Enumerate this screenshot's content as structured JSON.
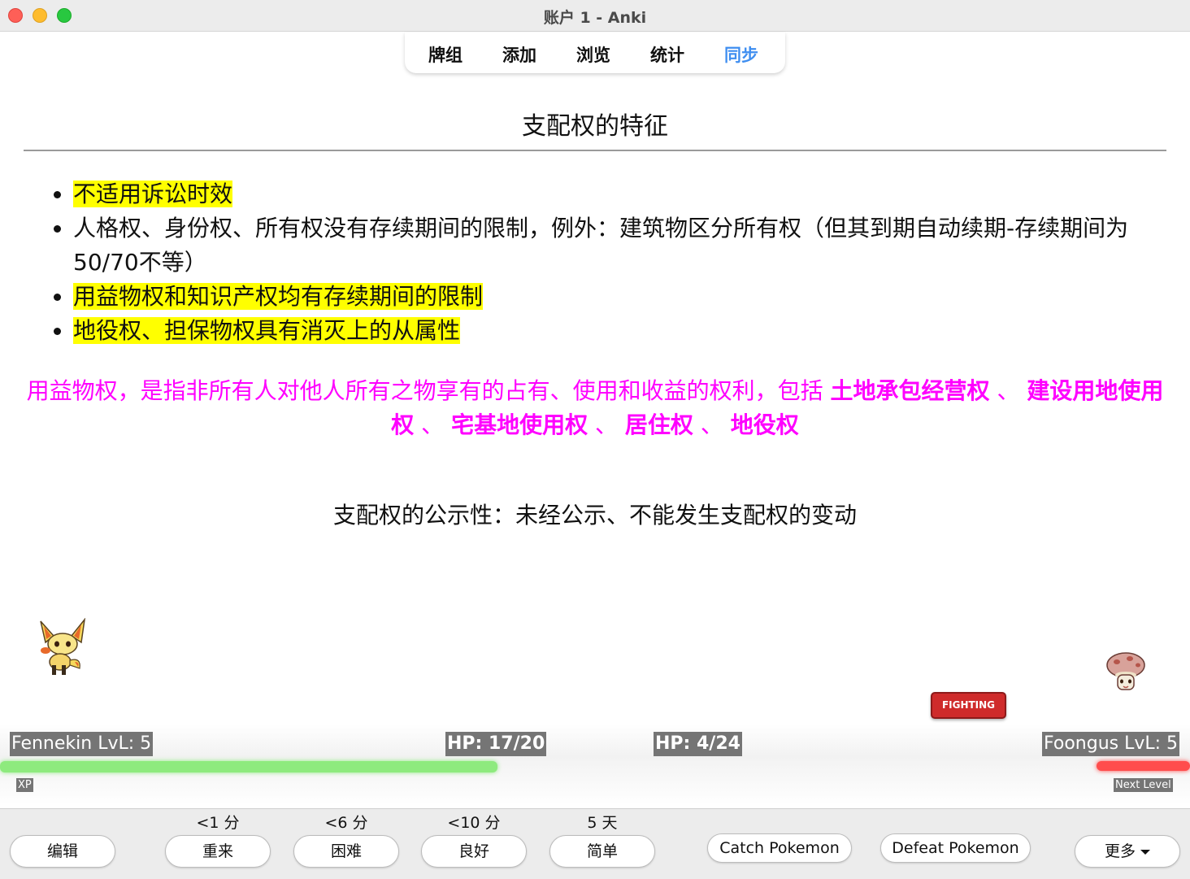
{
  "window": {
    "title": "账户 1 - Anki"
  },
  "toolbar": {
    "items": [
      {
        "label": "牌组"
      },
      {
        "label": "添加"
      },
      {
        "label": "浏览"
      },
      {
        "label": "统计"
      },
      {
        "label": "同步",
        "active": true
      }
    ]
  },
  "card": {
    "title": "支配权的特征",
    "bullets": [
      {
        "text": "不适用诉讼时效",
        "highlight": true
      },
      {
        "text": "人格权、身份权、所有权没有存续期间的限制，例外：建筑物区分所有权（但其到期自动续期-存续期间为50/70不等）",
        "highlight": false
      },
      {
        "text": "用益物权和知识产权均有存续期间的限制",
        "highlight": true
      },
      {
        "text": "地役权、担保物权具有消灭上的从属性",
        "highlight": true
      }
    ],
    "usufruct": {
      "prefix": "用益物权，是指非所有人对他人所有之物享有的占有、使用和收益的权利，包括 ",
      "items": [
        "土地承包经营权",
        "建设用地使用权",
        "宅基地使用权",
        "居住权",
        "地役权"
      ],
      "separator": " 、 "
    },
    "publicity": "支配权的公示性：未经公示、不能发生支配权的变动"
  },
  "pokemon": {
    "player": {
      "label": "Fennekin LvL: 5",
      "hp": "HP: 17/20",
      "hp_fraction": 0.85,
      "xp_label": "XP",
      "sprite": "fennekin-sprite"
    },
    "enemy": {
      "label": "Foongus LvL: 5",
      "hp": "HP: 4/24",
      "hp_fraction": 0.167,
      "next_level_label": "Next Level",
      "sprite": "foongus-sprite"
    },
    "fight_button": "FIGHTING",
    "colors": {
      "player_bar": "#8eea7e",
      "enemy_bar": "#ff4d4d"
    }
  },
  "answer_bar": {
    "edit": "编辑",
    "answers": [
      {
        "due": "<1 分",
        "label": "重来"
      },
      {
        "due": "<6 分",
        "label": "困难"
      },
      {
        "due": "<10 分",
        "label": "良好"
      },
      {
        "due": "5 天",
        "label": "简单"
      }
    ],
    "catch": "Catch Pokemon",
    "defeat": "Defeat Pokemon",
    "more": "更多"
  }
}
